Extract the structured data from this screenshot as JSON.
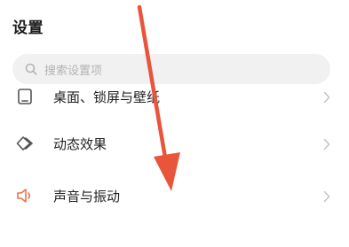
{
  "header": {
    "title": "设置"
  },
  "search": {
    "placeholder": "搜索设置项"
  },
  "settings_list": {
    "items": [
      {
        "label": "桌面、锁屏与壁纸",
        "icon": "desktop-icon"
      },
      {
        "label": "动态效果",
        "icon": "animation-diamond-icon"
      },
      {
        "label": "声音与振动",
        "icon": "speaker-icon"
      }
    ]
  },
  "colors": {
    "accent_arrow": "#e8553a",
    "icon_stroke": "#555555",
    "speaker_icon": "#e7744f",
    "chevron": "#c4c4c4",
    "search_bg": "#f1f1f1"
  },
  "annotation": {
    "type": "red-arrow-pointing-down"
  }
}
